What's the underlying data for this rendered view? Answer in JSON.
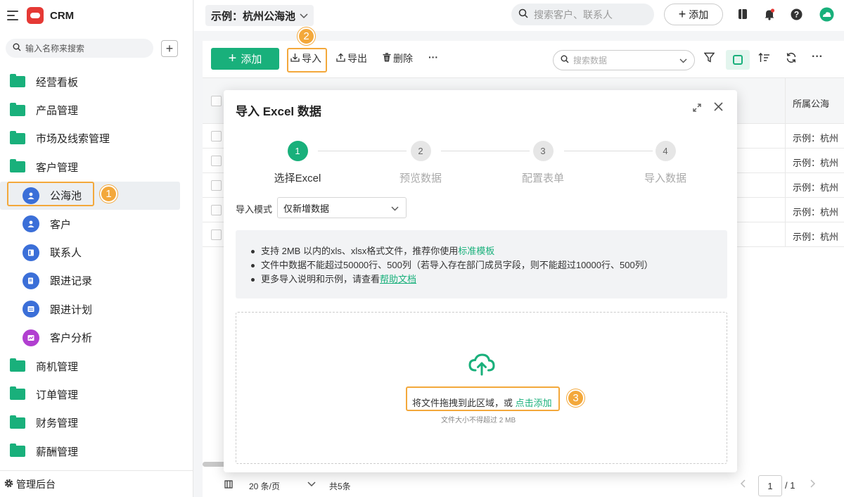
{
  "app": {
    "name": "CRM"
  },
  "sidebar": {
    "search_placeholder": "输入名称来搜索",
    "add_label": "+",
    "items": [
      {
        "label": "经营看板",
        "icon": "folder-icon"
      },
      {
        "label": "产品管理",
        "icon": "folder-icon"
      },
      {
        "label": "市场及线索管理",
        "icon": "folder-icon"
      },
      {
        "label": "客户管理",
        "icon": "folder-open-icon"
      },
      {
        "label": "公海池",
        "icon": "pool-icon",
        "active": true
      },
      {
        "label": "客户",
        "icon": "customer-icon"
      },
      {
        "label": "联系人",
        "icon": "contact-icon"
      },
      {
        "label": "跟进记录",
        "icon": "record-icon"
      },
      {
        "label": "跟进计划",
        "icon": "plan-icon"
      },
      {
        "label": "客户分析",
        "icon": "analysis-icon"
      },
      {
        "label": "商机管理",
        "icon": "folder-icon"
      },
      {
        "label": "订单管理",
        "icon": "folder-icon"
      },
      {
        "label": "财务管理",
        "icon": "folder-icon"
      },
      {
        "label": "薪酬管理",
        "icon": "folder-icon"
      }
    ],
    "footer_label": "管理后台"
  },
  "topbar": {
    "workspace": "示例：杭州公海池",
    "search_placeholder": "搜索客户、联系人",
    "add_label": "添加"
  },
  "toolbar": {
    "add_label": "添加",
    "import_label": "导入",
    "export_label": "导出",
    "delete_label": "删除",
    "more_label": "···",
    "search_placeholder": "搜索数据"
  },
  "table": {
    "column_header": "所属公海",
    "rows": [
      "示例：杭州",
      "示例：杭州",
      "示例：杭州",
      "示例：杭州",
      "示例：杭州"
    ]
  },
  "footer": {
    "page_size": "20 条/页",
    "total": "共5条",
    "current_page": "1",
    "total_pages": "/ 1"
  },
  "modal": {
    "title": "导入 Excel 数据",
    "steps": [
      {
        "num": "1",
        "label": "选择Excel"
      },
      {
        "num": "2",
        "label": "预览数据"
      },
      {
        "num": "3",
        "label": "配置表单"
      },
      {
        "num": "4",
        "label": "导入数据"
      }
    ],
    "mode_label": "导入模式",
    "mode_value": "仅新增数据",
    "info": {
      "line1_prefix": "支持 2MB 以内的xls、xlsx格式文件，推荐你使用",
      "line1_link": "标准模板",
      "line2": "文件中数据不能超过50000行、500列（若导入存在部门成员字段，则不能超过10000行、500列）",
      "line3_prefix": "更多导入说明和示例，请查看",
      "line3_link": "帮助文档"
    },
    "drop_text": "将文件拖拽到此区域，或 ",
    "drop_link": "点击添加",
    "drop_sub": "文件大小不得超过 2 MB"
  },
  "annotations": {
    "n1": "1",
    "n2": "2",
    "n3": "3"
  },
  "colors": {
    "accent": "#19b07b",
    "highlight": "#f3a83b"
  }
}
